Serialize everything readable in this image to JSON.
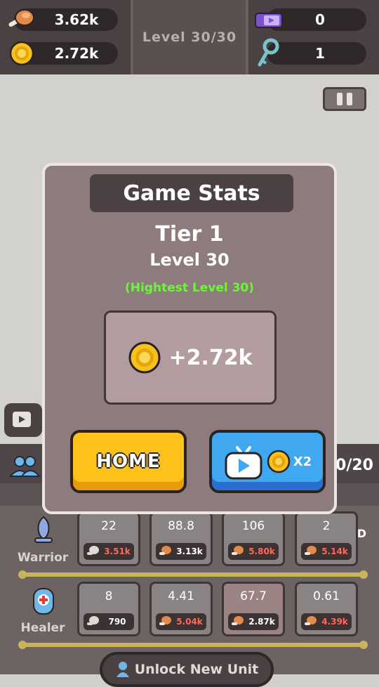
{
  "hud": {
    "meat": "3.62k",
    "coins": "2.72k",
    "level": "Level 30/30",
    "tickets": "0",
    "keys": "1"
  },
  "modal": {
    "title": "Game Stats",
    "tier": "Tier 1",
    "level": "Level 30",
    "highest": "(Hightest Level 30)",
    "reward": "+2.72k",
    "home_label": "HOME",
    "x2_label": "X2"
  },
  "bottom": {
    "count": "0/20",
    "spd_label": "SPD",
    "unlock_label": "Unlock New Unit",
    "units": [
      {
        "name": "Warrior",
        "cards": [
          {
            "value": "22",
            "cost": "3.51k",
            "affordable": false
          },
          {
            "value": "88.8",
            "cost": "3.13k",
            "affordable": true
          },
          {
            "value": "106",
            "cost": "5.80k",
            "affordable": false
          },
          {
            "value": "2",
            "cost": "5.14k",
            "affordable": false
          }
        ]
      },
      {
        "name": "Healer",
        "cards": [
          {
            "value": "8",
            "cost": "790",
            "affordable": true
          },
          {
            "value": "4.41",
            "cost": "5.04k",
            "affordable": false
          },
          {
            "value": "67.7",
            "cost": "2.87k",
            "affordable": true
          },
          {
            "value": "0.61",
            "cost": "4.39k",
            "affordable": false
          }
        ]
      }
    ]
  },
  "colors": {
    "highest": "#6df53b",
    "home": "#ffc21a",
    "x2": "#3fa8f0",
    "cost_red": "#ff6a5a"
  },
  "icons": [
    "meat-icon",
    "coin-icon",
    "ticket-icon",
    "key-icon",
    "pause-icon",
    "tv-icon",
    "team-icon",
    "warrior-icon",
    "healer-icon",
    "unlock-icon"
  ]
}
